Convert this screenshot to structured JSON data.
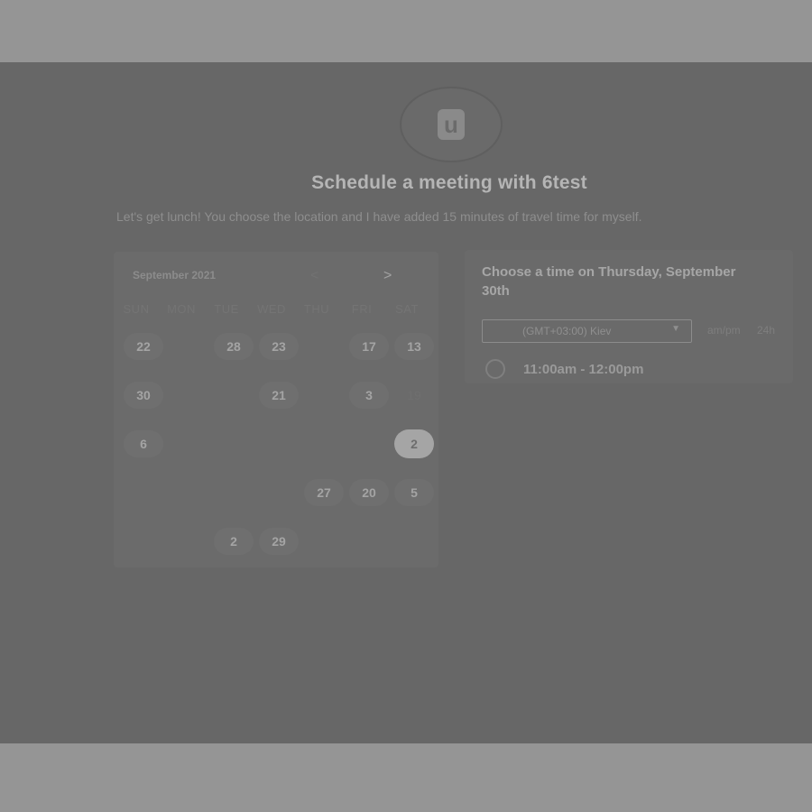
{
  "header": {
    "avatar_letter": "u",
    "title": "Schedule a meeting with 6test",
    "subtitle": "Let's get lunch! You choose the location and I have added 15 minutes of travel time for myself."
  },
  "calendar": {
    "month": "September 2021",
    "prev_icon": "chevron-left-icon",
    "next_icon": "chevron-right-icon",
    "weekdays": [
      "SUN",
      "MON",
      "TUE",
      "WED",
      "THU",
      "FRI",
      "SAT"
    ],
    "days": [
      {
        "label": "22",
        "state": "avail"
      },
      {
        "label": "28",
        "state": "avail"
      },
      {
        "label": "23",
        "state": "avail"
      },
      {
        "label": "17",
        "state": "avail"
      },
      {
        "label": "13",
        "state": "avail"
      },
      {
        "label": "30",
        "state": "avail"
      },
      {
        "label": "21",
        "state": "avail"
      },
      {
        "label": "3",
        "state": "avail"
      },
      {
        "label": "19",
        "state": "dim"
      },
      {
        "label": "6",
        "state": "avail"
      },
      {
        "label": "2",
        "state": "selected"
      },
      {
        "label": "27",
        "state": "avail"
      },
      {
        "label": "20",
        "state": "avail"
      },
      {
        "label": "5",
        "state": "avail"
      },
      {
        "label": "2",
        "state": "avail"
      },
      {
        "label": "29",
        "state": "avail"
      }
    ]
  },
  "time_panel": {
    "heading": "Choose a time on Thursday, September 30th",
    "timezone": "(GMT+03:00) Kiev",
    "format_ampm": "am/pm",
    "format_24h": "24h",
    "slot_label": "11:00am - 12:00pm"
  }
}
